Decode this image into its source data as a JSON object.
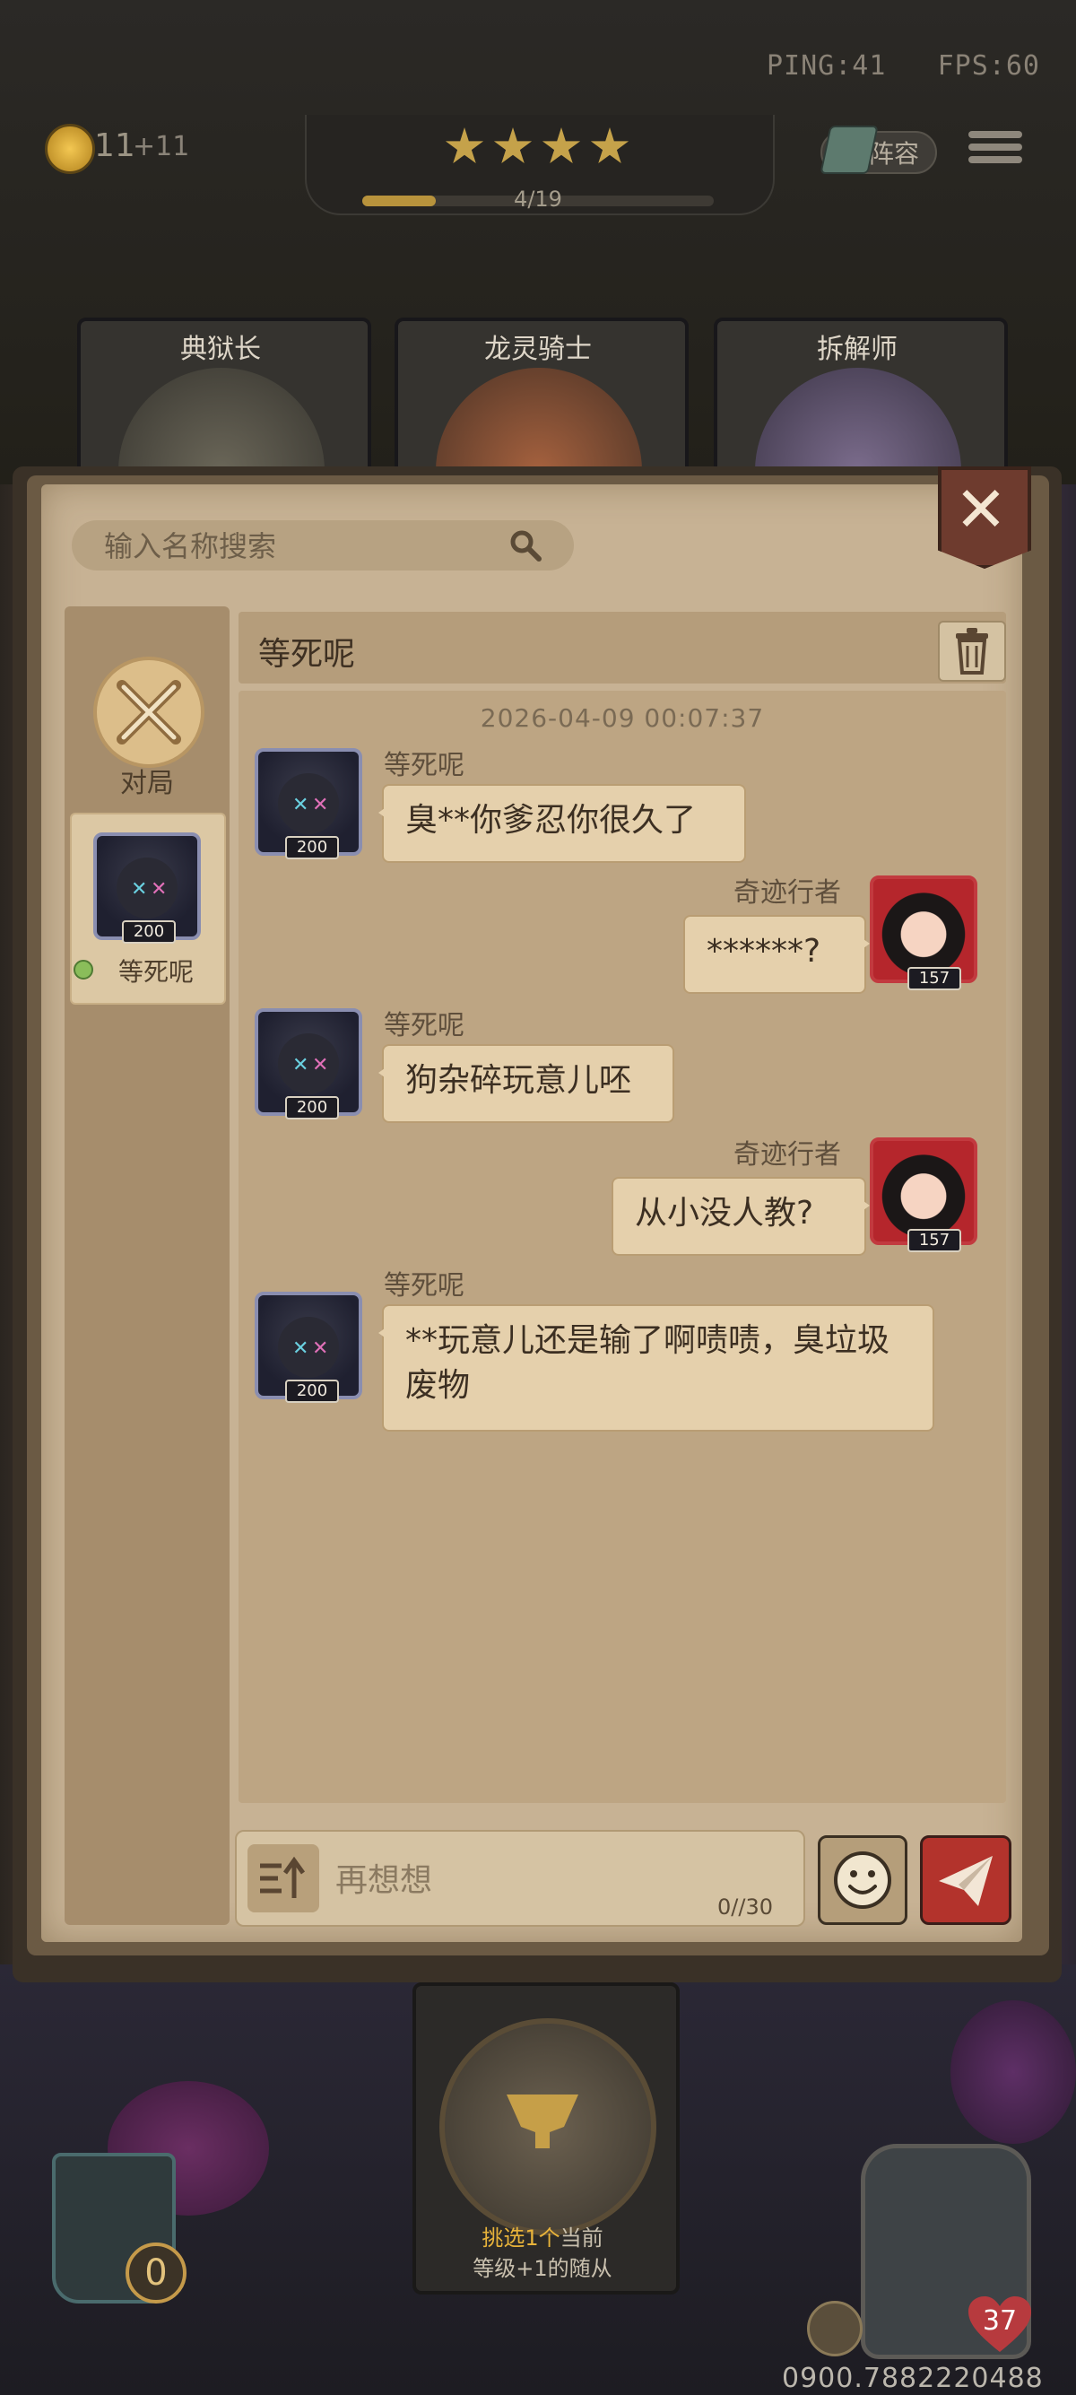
{
  "hud": {
    "ping": "PING:41",
    "fps": "FPS:60",
    "coins": "11",
    "coins_plus": "+11",
    "progress_text": "4/19",
    "progress_fraction": 0.21,
    "star_count": 4,
    "lineup_label": "阵容"
  },
  "heroes": [
    {
      "name": "典狱长"
    },
    {
      "name": "龙灵骑士"
    },
    {
      "name": "拆解师"
    }
  ],
  "dialog": {
    "search_placeholder": "输入名称搜索",
    "sidebar": {
      "battle_label": "对局",
      "contact": {
        "name": "等死呢",
        "level": "200",
        "online": true
      }
    },
    "chat_title": "等死呢",
    "timestamp": "2026-04-09  00:07:37",
    "messages": [
      {
        "sender": "等死呢",
        "level": "200",
        "side": "left",
        "text": "臭**你爹忍你很久了"
      },
      {
        "sender": "奇迹行者",
        "level": "157",
        "side": "right",
        "text": "******?"
      },
      {
        "sender": "等死呢",
        "level": "200",
        "side": "left",
        "text": "狗杂碎玩意儿呸"
      },
      {
        "sender": "奇迹行者",
        "level": "157",
        "side": "right",
        "text": "从小没人教?"
      },
      {
        "sender": "等死呢",
        "level": "200",
        "side": "left",
        "text": "**玩意儿还是输了啊啧啧，臭垃圾废物"
      }
    ],
    "compose": {
      "placeholder": "再想想",
      "char_count": "0//30"
    }
  },
  "bottom": {
    "pick_text_highlight": "挑选1个",
    "pick_text_rest": "当前",
    "pick_text_line2": "等级+1的随从",
    "shop_count": "0",
    "health": "37",
    "player_id": "0900.7882220488"
  },
  "colors": {
    "accent_gold": "#c5a24a",
    "send_red": "#b3332c",
    "online_green": "#8abd5a"
  }
}
